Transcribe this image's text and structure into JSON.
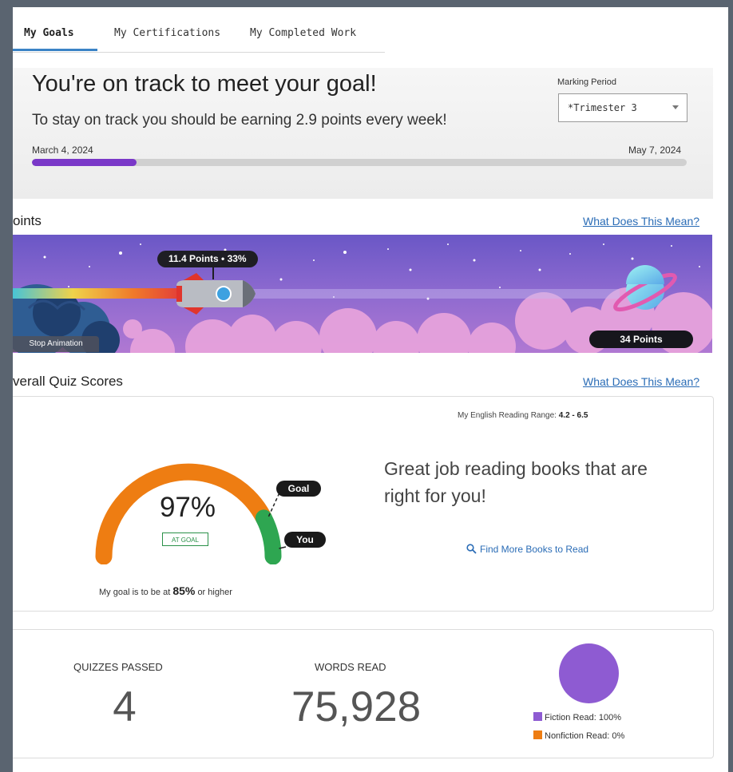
{
  "tabs": [
    {
      "label": "My Goals",
      "active": true
    },
    {
      "label": "My Certifications",
      "active": false
    },
    {
      "label": "My Completed Work",
      "active": false
    }
  ],
  "goal": {
    "title": "You're on track to meet your goal!",
    "subtitle": "To stay on track you should be earning 2.9 points every week!",
    "marking_period_label": "Marking Period",
    "marking_period_value": "*Trimester 3",
    "start_date": "March 4, 2024",
    "end_date": "May 7, 2024",
    "progress_fraction": 0.16,
    "progress_color": "#7a38c8"
  },
  "points_section": {
    "title": "oints",
    "link": "What Does This Mean?",
    "rocket_label": "11.4 Points • 33%",
    "goal_points": "34 Points",
    "stop_animation": "Stop Animation",
    "progress_fraction": 0.33
  },
  "quiz_section": {
    "title": "verall Quiz Scores",
    "link": "What Does This Mean?",
    "reading_range_label": "My English Reading Range:",
    "reading_range_value": "4.2 - 6.5",
    "percent": "97%",
    "score_value": 97,
    "goal_value": 85,
    "status_badge": "AT GOAL",
    "goal_marker": "Goal",
    "you_marker": "You",
    "goal_text_prefix": "My goal is to be at",
    "goal_text_value": "85%",
    "goal_text_suffix": "or higher",
    "message": "Great job reading books that are right for you!",
    "find_link": "Find More Books to Read",
    "colors": {
      "gauge_below": "#ee7d12",
      "gauge_above": "#2ea651"
    }
  },
  "stats": {
    "quizzes_label": "QUIZZES PASSED",
    "quizzes_value": "4",
    "words_label": "WORDS READ",
    "words_value": "75,928",
    "fiction_label": "Fiction Read: 100%",
    "nonfiction_label": "Nonfiction Read: 0%",
    "fiction_fraction": 1.0,
    "nonfiction_fraction": 0.0,
    "colors": {
      "fiction": "#8e5bd2",
      "nonfiction": "#ee7d12"
    }
  }
}
